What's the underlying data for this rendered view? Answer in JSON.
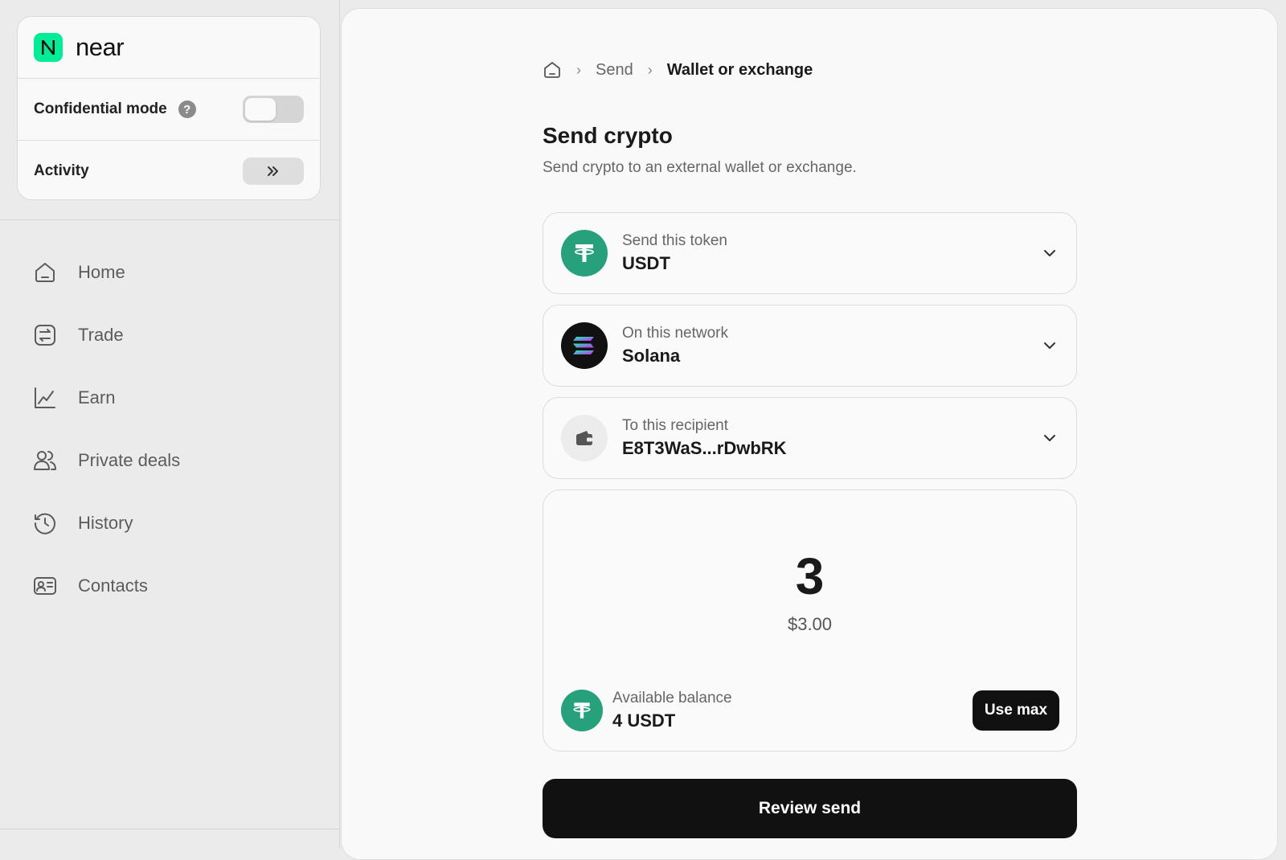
{
  "brand": {
    "name": "near",
    "accent": "#00ec97"
  },
  "sidebar": {
    "confidential_mode": {
      "label": "Confidential mode",
      "enabled": false,
      "help_icon": "question-icon"
    },
    "activity": {
      "label": "Activity",
      "icon": "double-chevron-right-icon"
    },
    "nav": [
      {
        "label": "Home",
        "icon": "home-icon"
      },
      {
        "label": "Trade",
        "icon": "trade-icon"
      },
      {
        "label": "Earn",
        "icon": "chart-line-icon"
      },
      {
        "label": "Private deals",
        "icon": "users-icon"
      },
      {
        "label": "History",
        "icon": "history-icon"
      },
      {
        "label": "Contacts",
        "icon": "contact-card-icon"
      }
    ]
  },
  "breadcrumb": {
    "home_icon": "home-icon",
    "items": [
      "Send",
      "Wallet or exchange"
    ]
  },
  "page": {
    "title": "Send crypto",
    "subtitle": "Send crypto to an external wallet or exchange."
  },
  "token_select": {
    "label": "Send this token",
    "value": "USDT",
    "icon": "tether-icon",
    "color": "#26a17b"
  },
  "network_select": {
    "label": "On this network",
    "value": "Solana",
    "icon": "solana-icon",
    "color": "#111111"
  },
  "recipient_select": {
    "label": "To this recipient",
    "value": "E8T3WaS...rDwbRK",
    "icon": "wallet-icon"
  },
  "amount": {
    "value": "3",
    "usd": "$3.00",
    "balance_label": "Available balance",
    "balance_value": "4 USDT",
    "use_max_label": "Use max"
  },
  "review_button": {
    "label": "Review send"
  }
}
